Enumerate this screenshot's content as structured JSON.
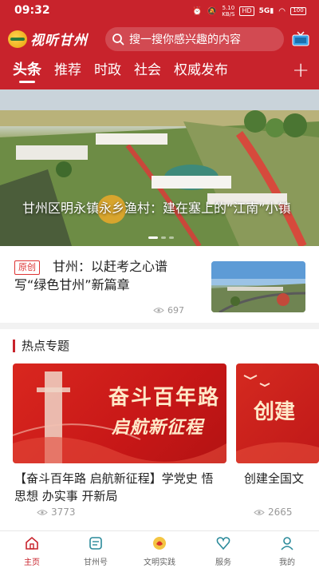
{
  "status": {
    "time": "09:32",
    "net_speed_top": "5.10",
    "net_speed_unit": "KB/S",
    "net_type": "HD",
    "signal_label": "5G",
    "battery": "100"
  },
  "header": {
    "logo_text": "视听甘州",
    "search_placeholder": "搜一搜你感兴趣的内容",
    "tabs": [
      "头条",
      "推荐",
      "时政",
      "社会",
      "权威发布"
    ],
    "add_symbol": "+"
  },
  "hero": {
    "caption": "甘州区明永镇永乡渔村：建在塞上的“江南”小镇"
  },
  "news": {
    "badge": "原创",
    "title": "甘州：以赶考之心谱写“绿色甘州”新篇章",
    "views": "697"
  },
  "hot_topics": {
    "section_title": "热点专题",
    "cards": [
      {
        "banner_line1": "奋斗百年路",
        "banner_line2": "启航新征程",
        "caption": "【奋斗百年路 启航新征程】学党史 悟思想 办实事 开新局",
        "views": "3773"
      },
      {
        "banner_line1": "创建",
        "caption": "创建全国文",
        "views": "2665"
      }
    ]
  },
  "bottom_nav": [
    {
      "label": "主页",
      "icon": "home-icon"
    },
    {
      "label": "甘州号",
      "icon": "ganzhou-account-icon"
    },
    {
      "label": "文明实践",
      "icon": "civilization-icon"
    },
    {
      "label": "服务",
      "icon": "service-heart-icon"
    },
    {
      "label": "我的",
      "icon": "profile-icon"
    }
  ],
  "colors": {
    "brand_red": "#c8232c",
    "text_dark": "#222222",
    "muted": "#999999"
  }
}
